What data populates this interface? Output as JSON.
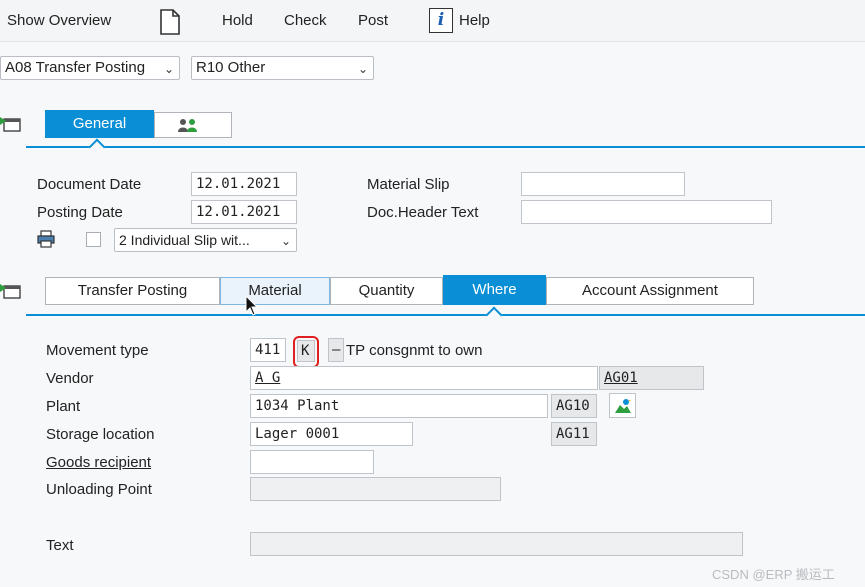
{
  "toolbar": {
    "show_overview": "Show Overview",
    "hold": "Hold",
    "check": "Check",
    "post": "Post",
    "help": "Help",
    "help_icon_glyph": "i"
  },
  "header_selects": {
    "transaction": "A08 Transfer Posting",
    "reference": "R10 Other"
  },
  "general_tabs": {
    "general": "General"
  },
  "general": {
    "document_date_label": "Document Date",
    "document_date": "12.01.2021",
    "posting_date_label": "Posting Date",
    "posting_date": "12.01.2021",
    "material_slip_label": "Material Slip",
    "material_slip": "",
    "doc_header_text_label": "Doc.Header Text",
    "doc_header_text": "",
    "print_option": "2 Individual Slip wit..."
  },
  "item_tabs": {
    "transfer_posting": "Transfer Posting",
    "material": "Material",
    "quantity": "Quantity",
    "where": "Where",
    "account_assignment": "Account Assignment"
  },
  "where": {
    "movement_type_label": "Movement type",
    "movement_type": "411",
    "special_stock": "K",
    "dash": "–",
    "movement_text": "TP consgnmt to own",
    "vendor_label": "Vendor",
    "vendor": "A G",
    "vendor_code": "AG01",
    "plant_label": "Plant",
    "plant": "1034 Plant",
    "plant_code": "AG10",
    "storage_location_label": "Storage location",
    "storage_location": "Lager 0001",
    "storage_code": "AG11",
    "goods_recipient_label": "Goods recipient",
    "goods_recipient": "",
    "unloading_point_label": "Unloading Point",
    "unloading_point": "",
    "text_label": "Text",
    "text": ""
  },
  "watermark": "CSDN @ERP 搬运工",
  "colors": {
    "accent": "#0a8fd6",
    "highlight": "#e02020"
  }
}
